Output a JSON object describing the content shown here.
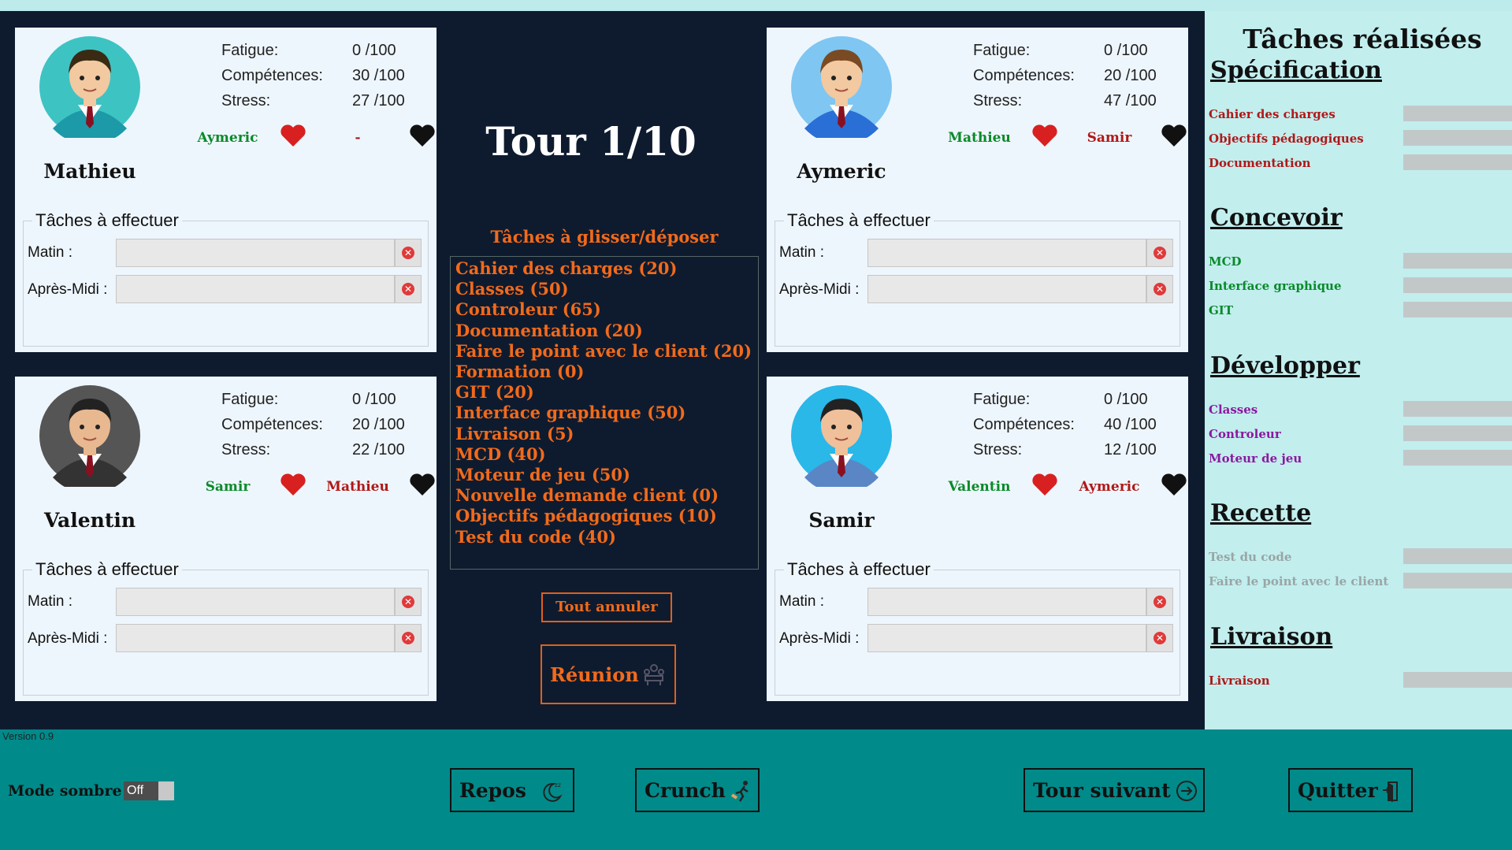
{
  "game": {
    "turn_label": "Tour 1/10",
    "dragdrop_title": "Tâches à glisser/déposer",
    "tasks": [
      "Cahier des charges (20)",
      "Classes (50)",
      "Controleur (65)",
      "Documentation (20)",
      "Faire le point avec le client (20)",
      "Formation (0)",
      "GIT (20)",
      "Interface graphique  (50)",
      "Livraison (5)",
      "MCD (40)",
      "Moteur de jeu (50)",
      "Nouvelle demande client (0)",
      "Objectifs pédagogiques (10)",
      "Test du code (40)"
    ],
    "cancel_all": "Tout annuler",
    "meeting": "Réunion"
  },
  "labels": {
    "fatigue": "Fatigue:",
    "competences": "Compétences:",
    "stress": "Stress:",
    "tasks_legend": "Tâches à effectuer",
    "morning": "Matin :",
    "afternoon": "Après-Midi :"
  },
  "players": [
    {
      "name": "Mathieu",
      "fatigue": "0  /100",
      "competences": "30  /100",
      "stress": "27  /100",
      "likes": "Aymeric",
      "dislikes": "-"
    },
    {
      "name": "Aymeric",
      "fatigue": "0  /100",
      "competences": "20  /100",
      "stress": "47  /100",
      "likes": "Mathieu",
      "dislikes": "Samir"
    },
    {
      "name": "Valentin",
      "fatigue": "0  /100",
      "competences": "20  /100",
      "stress": "22  /100",
      "likes": "Samir",
      "dislikes": "Mathieu"
    },
    {
      "name": "Samir",
      "fatigue": "0  /100",
      "competences": "40  /100",
      "stress": "12  /100",
      "likes": "Valentin",
      "dislikes": "Aymeric"
    }
  ],
  "sidebar": {
    "title": "Tâches réalisées",
    "sections": [
      {
        "title": "Spécification",
        "color": "#b01818",
        "items": [
          "Cahier des charges",
          "Objectifs pédagogiques",
          "Documentation"
        ]
      },
      {
        "title": "Concevoir",
        "color": "#0a8a2a",
        "items": [
          "MCD",
          "Interface graphique",
          "GIT"
        ]
      },
      {
        "title": "Développer",
        "color": "#8a1aa0",
        "items": [
          "Classes",
          "Controleur",
          "Moteur de jeu"
        ]
      },
      {
        "title": "Recette",
        "color": "#9aa5a5",
        "items": [
          "Test du code",
          "Faire le point avec le client"
        ]
      },
      {
        "title": "Livraison",
        "color": "#b01818",
        "items": [
          "Livraison"
        ]
      }
    ]
  },
  "footer": {
    "version": "Version 0.9",
    "dark_mode_label": "Mode sombre",
    "dark_mode_state": "Off",
    "rest": "Repos",
    "crunch": "Crunch",
    "next_turn": "Tour suivant",
    "quit": "Quitter"
  },
  "icons": {
    "heart_like": "heart-icon-red",
    "heart_dislike": "heart-icon-black",
    "clear": "clear-icon",
    "rest": "moon-sleep-icon",
    "crunch": "runner-icon",
    "next": "arrow-circle-icon",
    "quit": "exit-door-icon",
    "meeting": "meeting-icon"
  }
}
